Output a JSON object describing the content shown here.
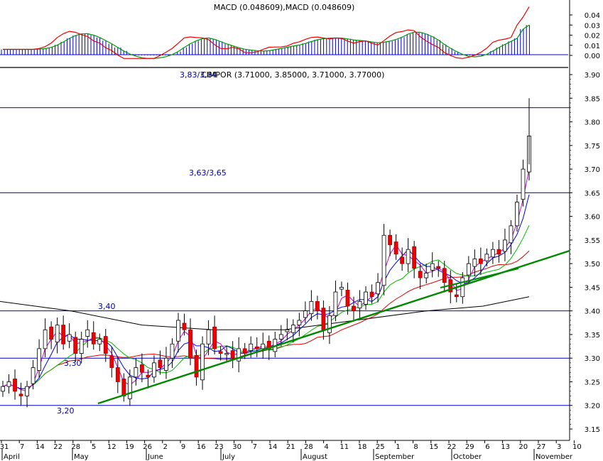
{
  "chart_data": {
    "type": "candlestick",
    "macd_title": "MACD (0.048609),MACD (0.048609)",
    "price_title": "CIMPOR (3.71000, 3.85000, 3.71000, 3.77000)",
    "top_label": "3,83/3,84",
    "resistance_label": "3,63/3,65",
    "support_labels": [
      "3,40",
      "3,30",
      "3,20"
    ],
    "macd_y_ticks": [
      "0.04",
      "0.03",
      "0.02",
      "0.01",
      "0.00"
    ],
    "price_y_ticks": [
      "3.90",
      "3.85",
      "3.80",
      "3.75",
      "3.70",
      "3.65",
      "3.60",
      "3.55",
      "3.50",
      "3.45",
      "3.40",
      "3.35",
      "3.30",
      "3.25",
      "3.20",
      "3.15"
    ],
    "x_day_labels": [
      "31",
      "7",
      "14",
      "22",
      "28",
      "5",
      "12",
      "19",
      "26",
      "2",
      "9",
      "16",
      "23",
      "30",
      "7",
      "14",
      "21",
      "28",
      "4",
      "11",
      "18",
      "25",
      "1",
      "8",
      "15",
      "22",
      "29",
      "6",
      "13",
      "20",
      "27",
      "3",
      "10"
    ],
    "x_month_labels": [
      "April",
      "May",
      "June",
      "July",
      "August",
      "September",
      "October",
      "November"
    ],
    "horizontal_levels": [
      3.83,
      3.65,
      3.4,
      3.3,
      3.2
    ],
    "trendlines": [
      {
        "name": "support-main",
        "from": [
          3.2
        ],
        "to": [
          3.525
        ]
      },
      {
        "name": "support-upper",
        "from": [
          3.46
        ],
        "to": [
          3.49
        ]
      }
    ],
    "ohlc_close_path": [
      3.24,
      3.25,
      3.23,
      3.22,
      3.24,
      3.28,
      3.32,
      3.36,
      3.34,
      3.37,
      3.33,
      3.35,
      3.31,
      3.34,
      3.36,
      3.33,
      3.34,
      3.31,
      3.28,
      3.25,
      3.22,
      3.26,
      3.28,
      3.27,
      3.26,
      3.29,
      3.28,
      3.3,
      3.33,
      3.38,
      3.36,
      3.3,
      3.26,
      3.33,
      3.36,
      3.32,
      3.31,
      3.31,
      3.3,
      3.32,
      3.31,
      3.33,
      3.32,
      3.33,
      3.32,
      3.34,
      3.35,
      3.36,
      3.37,
      3.38,
      3.4,
      3.42,
      3.4,
      3.36,
      3.39,
      3.44,
      3.45,
      3.41,
      3.4,
      3.42,
      3.44,
      3.43,
      3.46,
      3.56,
      3.54,
      3.52,
      3.5,
      3.53,
      3.49,
      3.47,
      3.48,
      3.5,
      3.49,
      3.46,
      3.44,
      3.43,
      3.47,
      3.5,
      3.51,
      3.5,
      3.52,
      3.53,
      3.52,
      3.55,
      3.58,
      3.63,
      3.7,
      3.77
    ]
  }
}
